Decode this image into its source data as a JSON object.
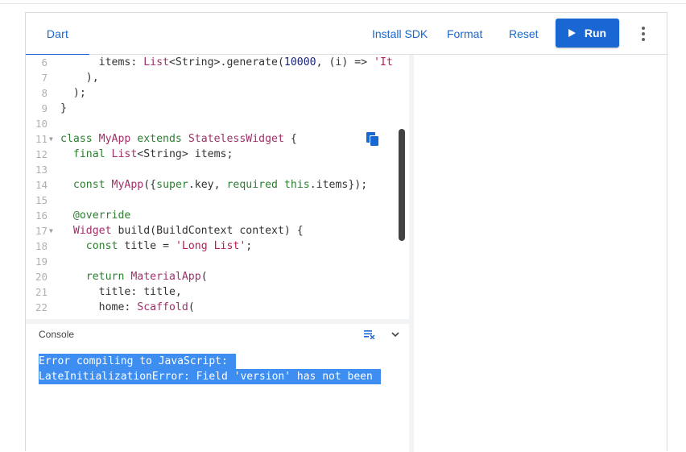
{
  "toolbar": {
    "tab_label": "Dart",
    "install_sdk_label": "Install SDK",
    "format_label": "Format",
    "reset_label": "Reset",
    "run_label": "Run"
  },
  "editor": {
    "lines": [
      {
        "num": "6",
        "fold": "",
        "tokens": [
          [
            "pn",
            "      items: "
          ],
          [
            "ty",
            "List"
          ],
          [
            "pn",
            "<String>.generate("
          ],
          [
            "nm",
            "10000"
          ],
          [
            "pn",
            ", (i) => "
          ],
          [
            "st",
            "'It"
          ]
        ]
      },
      {
        "num": "7",
        "fold": "",
        "tokens": [
          [
            "pn",
            "    ),"
          ]
        ]
      },
      {
        "num": "8",
        "fold": "",
        "tokens": [
          [
            "pn",
            "  );"
          ]
        ]
      },
      {
        "num": "9",
        "fold": "",
        "tokens": [
          [
            "pn",
            "}"
          ]
        ]
      },
      {
        "num": "10",
        "fold": "",
        "tokens": []
      },
      {
        "num": "11",
        "fold": "▼",
        "tokens": [
          [
            "kw",
            "class "
          ],
          [
            "ty",
            "MyApp "
          ],
          [
            "kw",
            "extends "
          ],
          [
            "ty",
            "StatelessWidget"
          ],
          [
            "pn",
            " {"
          ]
        ]
      },
      {
        "num": "12",
        "fold": "",
        "tokens": [
          [
            "kw",
            "  final "
          ],
          [
            "ty",
            "List"
          ],
          [
            "pn",
            "<String> items;"
          ]
        ]
      },
      {
        "num": "13",
        "fold": "",
        "tokens": []
      },
      {
        "num": "14",
        "fold": "",
        "tokens": [
          [
            "kw",
            "  const "
          ],
          [
            "ty",
            "MyApp"
          ],
          [
            "pn",
            "({"
          ],
          [
            "kw",
            "super"
          ],
          [
            "pn",
            ".key, "
          ],
          [
            "kw",
            "required "
          ],
          [
            "kw",
            "this"
          ],
          [
            "pn",
            ".items});"
          ]
        ]
      },
      {
        "num": "15",
        "fold": "",
        "tokens": []
      },
      {
        "num": "16",
        "fold": "",
        "tokens": [
          [
            "an",
            "  @override"
          ]
        ]
      },
      {
        "num": "17",
        "fold": "▼",
        "tokens": [
          [
            "ty",
            "  Widget "
          ],
          [
            "pn",
            "build(BuildContext context) {"
          ]
        ]
      },
      {
        "num": "18",
        "fold": "",
        "tokens": [
          [
            "kw",
            "    const "
          ],
          [
            "pn",
            "title = "
          ],
          [
            "st",
            "'Long List'"
          ],
          [
            "pn",
            ";"
          ]
        ]
      },
      {
        "num": "19",
        "fold": "",
        "tokens": []
      },
      {
        "num": "20",
        "fold": "",
        "tokens": [
          [
            "kw",
            "    return "
          ],
          [
            "ty",
            "MaterialApp"
          ],
          [
            "pn",
            "("
          ]
        ]
      },
      {
        "num": "21",
        "fold": "",
        "tokens": [
          [
            "pn",
            "      title: title,"
          ]
        ]
      },
      {
        "num": "22",
        "fold": "",
        "tokens": [
          [
            "pn",
            "      home: "
          ],
          [
            "ty",
            "Scaffold"
          ],
          [
            "pn",
            "("
          ]
        ]
      }
    ]
  },
  "console": {
    "title": "Console",
    "lines": [
      "Error compiling to JavaScript: ",
      "LateInitializationError: Field 'version' has not been "
    ]
  },
  "icons": {
    "copy": "copy-icon",
    "clear": "clear-console-icon",
    "collapse": "chevron-down-icon",
    "menu": "more-vert-icon",
    "run": "play-icon"
  },
  "colors": {
    "accent": "#1967d2",
    "selection": "#3d8ef0"
  }
}
